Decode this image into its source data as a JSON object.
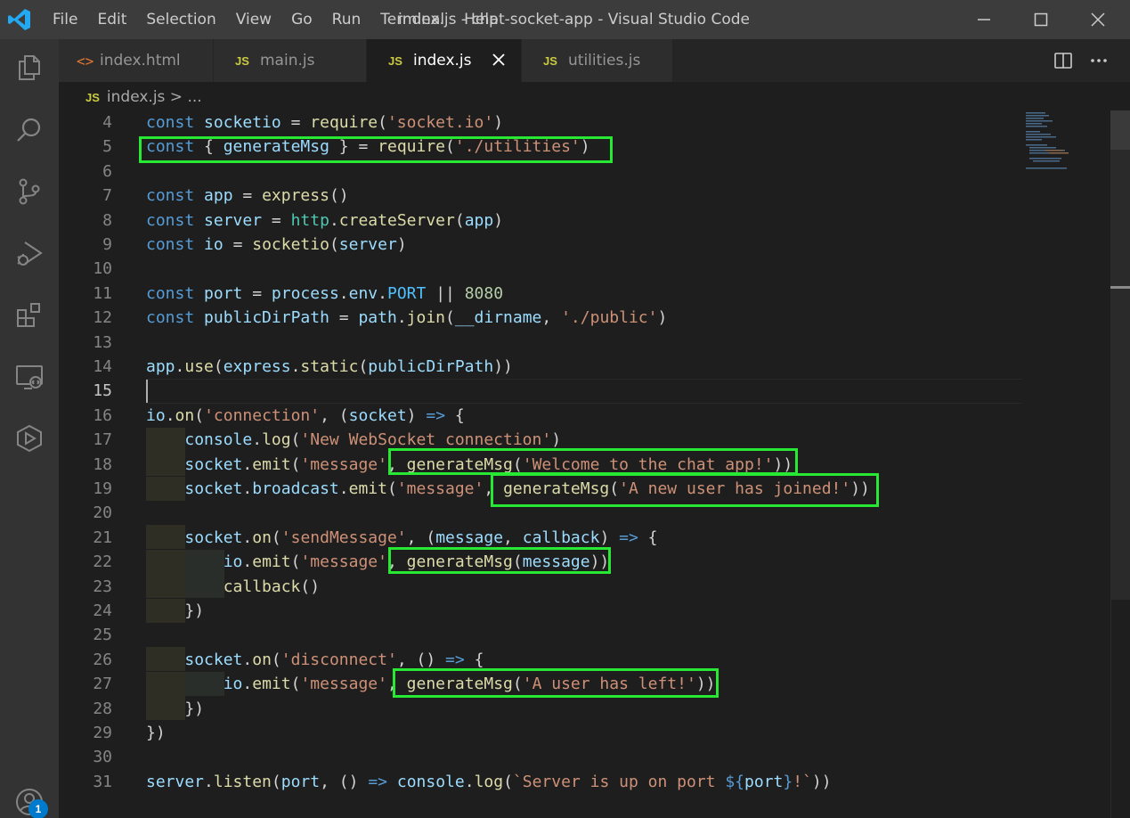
{
  "window": {
    "title": "index.js - chat-socket-app - Visual Studio Code",
    "menu": [
      "File",
      "Edit",
      "Selection",
      "View",
      "Go",
      "Run",
      "Terminal",
      "Help"
    ]
  },
  "activity": {
    "icons": [
      "files-icon",
      "search-icon",
      "source-control-icon",
      "run-debug-icon",
      "extensions-icon",
      "remote-explorer-icon",
      "live-share-icon",
      "account-icon"
    ],
    "account_badge": "1"
  },
  "tabs": [
    {
      "label": "index.html",
      "icon": "<>",
      "active": false
    },
    {
      "label": "main.js",
      "icon": "JS",
      "active": false
    },
    {
      "label": "index.js",
      "icon": "JS",
      "active": true
    },
    {
      "label": "utilities.js",
      "icon": "JS",
      "active": false
    }
  ],
  "breadcrumb": {
    "icon": "JS",
    "file": "index.js",
    "sep": " > ",
    "more": "..."
  },
  "editor": {
    "current_line": "15",
    "lines": [
      {
        "n": "4"
      },
      {
        "n": "5"
      },
      {
        "n": "6"
      },
      {
        "n": "7"
      },
      {
        "n": "8"
      },
      {
        "n": "9"
      },
      {
        "n": "10"
      },
      {
        "n": "11"
      },
      {
        "n": "12"
      },
      {
        "n": "13"
      },
      {
        "n": "14"
      },
      {
        "n": "15"
      },
      {
        "n": "16"
      },
      {
        "n": "17"
      },
      {
        "n": "18"
      },
      {
        "n": "19"
      },
      {
        "n": "20"
      },
      {
        "n": "21"
      },
      {
        "n": "22"
      },
      {
        "n": "23"
      },
      {
        "n": "24"
      },
      {
        "n": "25"
      },
      {
        "n": "26"
      },
      {
        "n": "27"
      },
      {
        "n": "28"
      },
      {
        "n": "29"
      },
      {
        "n": "30"
      },
      {
        "n": "31"
      }
    ]
  },
  "colors": {
    "keyword": "#569cd6",
    "variable": "#9cdcfe",
    "function": "#dcdcaa",
    "string": "#ce9178",
    "number": "#b5cea8",
    "highlight_box": "#27e832",
    "accent": "#007acc"
  }
}
